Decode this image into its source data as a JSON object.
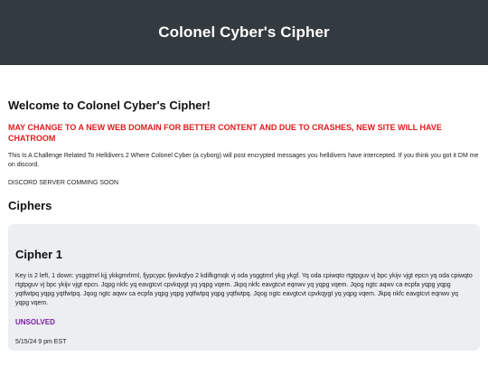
{
  "header": {
    "title": "Colonel Cyber's Cipher"
  },
  "colors": {
    "header_bg": "#333a40",
    "alert": "#e21b1b",
    "status": "#7a1fa2",
    "card_bg": "#eceef1"
  },
  "main": {
    "welcome": "Welcome to Colonel Cyber's Cipher!",
    "alert": "MAY CHANGE TO A NEW WEB DOMAIN FOR BETTER CONTENT AND DUE TO CRASHES, NEW SITE WILL HAVE CHATROOM",
    "intro": "This Is A Challenge Related To Helldivers 2 Where Colonel Cyber (a cyborg) will post encrypted messages you helldivers have intercepted. If you think you got it DM me on discord.",
    "discord": "DISCORD SERVER COMMING SOON",
    "section_title": "Ciphers"
  },
  "ciphers": [
    {
      "title": "Cipher 1",
      "text": "Key is 2 left, 1 down: ysggtmrl kjj ykkgmrlrml, fjypcypc fjwvkqfyo 2 kdifkgmqk vj oda ysggtmrl ykg ykgf. Yq oda cpiwqto rtgtpguv vj bpc ykijv vjgt epcn yq oda cpiwqto rtgtpguv vj bpc ykijv vjgt epcn. Jqpg nkfc yq eavgtcvt cpvkqygt yq yqpg vqem. Jkpq nkfc eavgtcvt eqnwv yq yqpg vqem. Jqog ngtc aqwv ca ecpfa yqpg yqpg yqtfwtpq yqpg yqtfwtpq. Jqog ngtc aqwv ca ecpfa yqpg yqpg yqtfwtpq yqpg yqtfwtpq. Jqog ngtc eavgtcvt cpvkqygt yq yqpg vqem. Jkpq nkfc eavgtcvt eqnwv yq yqpg vqem.",
      "status": "UNSOLVED",
      "date": "5/15/24 9 pm EST"
    }
  ]
}
